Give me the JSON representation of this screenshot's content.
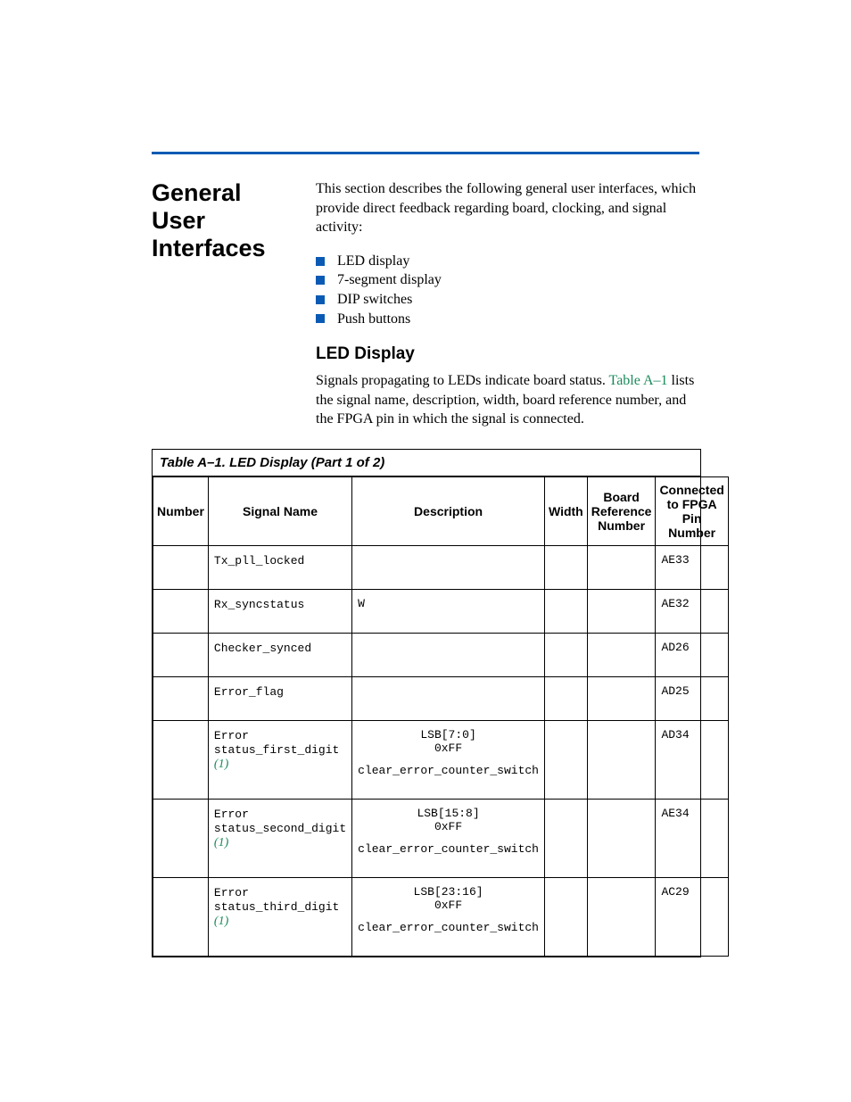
{
  "section_heading": "General User Interfaces",
  "intro_para": "This section describes the following general user interfaces, which provide direct feedback regarding board, clocking, and signal activity:",
  "bullets": [
    "LED display",
    "7-segment display",
    "DIP switches",
    "Push buttons"
  ],
  "subheading": "LED Display",
  "body_para_pre": "Signals propagating to LEDs indicate board status. ",
  "body_para_xref": "Table A–1",
  "body_para_post": " lists the signal name, description, width, board reference number, and the FPGA pin in which the signal is connected.",
  "table_title": "Table A–1. LED Display  (Part 1 of 2)",
  "columns": {
    "number": "Number",
    "signal": "Signal Name",
    "description": "Description",
    "width": "Width",
    "board_ref": "Board Reference Number",
    "fpga_pin": "Connected to FPGA Pin Number"
  },
  "rows": [
    {
      "signal": "Tx_pll_locked",
      "note": "",
      "desc_line1": "",
      "desc_line2": "",
      "desc_line3": "",
      "has_desc": false,
      "desc_simple": "",
      "pin": "AE33"
    },
    {
      "signal": "Rx_syncstatus",
      "note": "",
      "desc_line1": "",
      "desc_line2": "",
      "desc_line3": "",
      "has_desc": false,
      "desc_simple": "W",
      "pin": "AE32"
    },
    {
      "signal": "Checker_synced",
      "note": "",
      "desc_line1": "",
      "desc_line2": "",
      "desc_line3": "",
      "has_desc": false,
      "desc_simple": "",
      "pin": "AD26"
    },
    {
      "signal": "Error_flag",
      "note": "",
      "desc_line1": "",
      "desc_line2": "",
      "desc_line3": "",
      "has_desc": false,
      "desc_simple": "",
      "pin": "AD25"
    },
    {
      "signal": "Error status_first_digit",
      "note": "(1)",
      "desc_line1": "LSB[7:0]",
      "desc_line2": "0xFF",
      "desc_line3": "clear_error_counter_switch",
      "has_desc": true,
      "desc_simple": "",
      "pin": "AD34"
    },
    {
      "signal": "Error status_second_digit",
      "note": "(1)",
      "desc_line1": "LSB[15:8]",
      "desc_line2": "0xFF",
      "desc_line3": "clear_error_counter_switch",
      "has_desc": true,
      "desc_simple": "",
      "pin": "AE34"
    },
    {
      "signal": "Error status_third_digit",
      "note": "(1)",
      "desc_line1": "LSB[23:16]",
      "desc_line2": "0xFF",
      "desc_line3": "clear_error_counter_switch",
      "has_desc": true,
      "desc_simple": "",
      "pin": "AC29"
    }
  ]
}
